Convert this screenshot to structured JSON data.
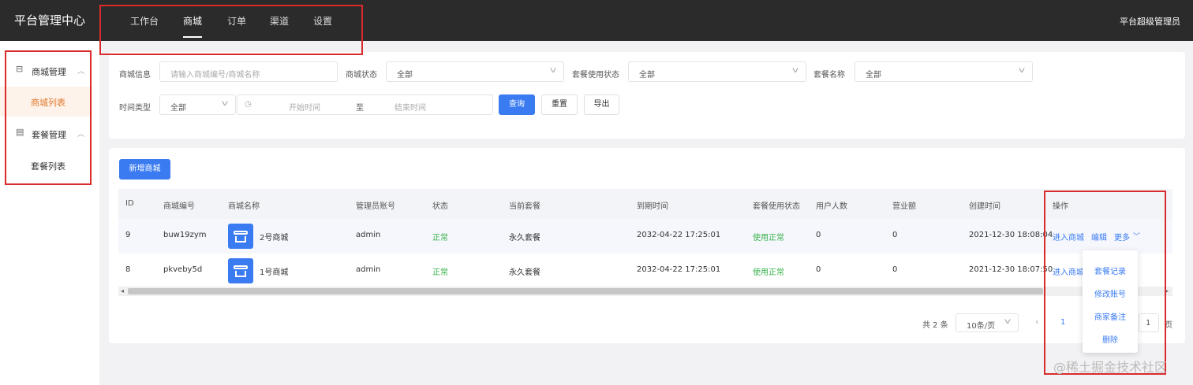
{
  "header": {
    "brand": "平台管理中心",
    "nav": [
      "工作台",
      "商城",
      "订单",
      "渠道",
      "设置"
    ],
    "user": "平台超级管理员"
  },
  "sidebar": {
    "groups": [
      {
        "label": "商城管理",
        "icon": "store-icon",
        "sub": "商城列表"
      },
      {
        "label": "套餐管理",
        "icon": "clipboard-icon",
        "sub": "套餐列表"
      }
    ]
  },
  "filters": {
    "shop_info_label": "商城信息",
    "shop_info_placeholder": "请输入商城编号/商城名称",
    "shop_status_label": "商城状态",
    "shop_status_value": "全部",
    "package_usage_label": "套餐使用状态",
    "package_usage_value": "全部",
    "package_name_label": "套餐名称",
    "package_name_value": "全部",
    "time_type_label": "时间类型",
    "time_type_value": "全部",
    "start_placeholder": "开始时间",
    "range_sep": "至",
    "end_placeholder": "结束时间",
    "query_btn": "查询",
    "reset_btn": "重置",
    "export_btn": "导出"
  },
  "add_btn": "新增商城",
  "table": {
    "headers": [
      "ID",
      "商城编号",
      "商城名称",
      "管理员账号",
      "状态",
      "当前套餐",
      "到期时间",
      "套餐使用状态",
      "用户人数",
      "营业额",
      "创建时间",
      "操作"
    ],
    "rows": [
      {
        "id": "9",
        "code": "buw19zym",
        "name": "2号商城",
        "admin": "admin",
        "status": "正常",
        "package": "永久套餐",
        "expire": "2032-04-22 17:25:01",
        "usage": "使用正常",
        "users": "0",
        "revenue": "0",
        "created": "2021-12-30 18:08:04"
      },
      {
        "id": "8",
        "code": "pkveby5d",
        "name": "1号商城",
        "admin": "admin",
        "status": "正常",
        "package": "永久套餐",
        "expire": "2032-04-22 17:25:01",
        "usage": "使用正常",
        "users": "0",
        "revenue": "0",
        "created": "2021-12-30 18:07:50"
      }
    ],
    "actions": {
      "enter": "进入商城",
      "edit": "编辑",
      "more": "更多"
    }
  },
  "dropdown": [
    "套餐记录",
    "修改账号",
    "商家备注",
    "删除"
  ],
  "pagination": {
    "total": "共 2 条",
    "page_size": "10条/页",
    "current": "1",
    "jump_value": "1",
    "jump_suffix": "页"
  },
  "watermark": "@稀土掘金技术社区"
}
